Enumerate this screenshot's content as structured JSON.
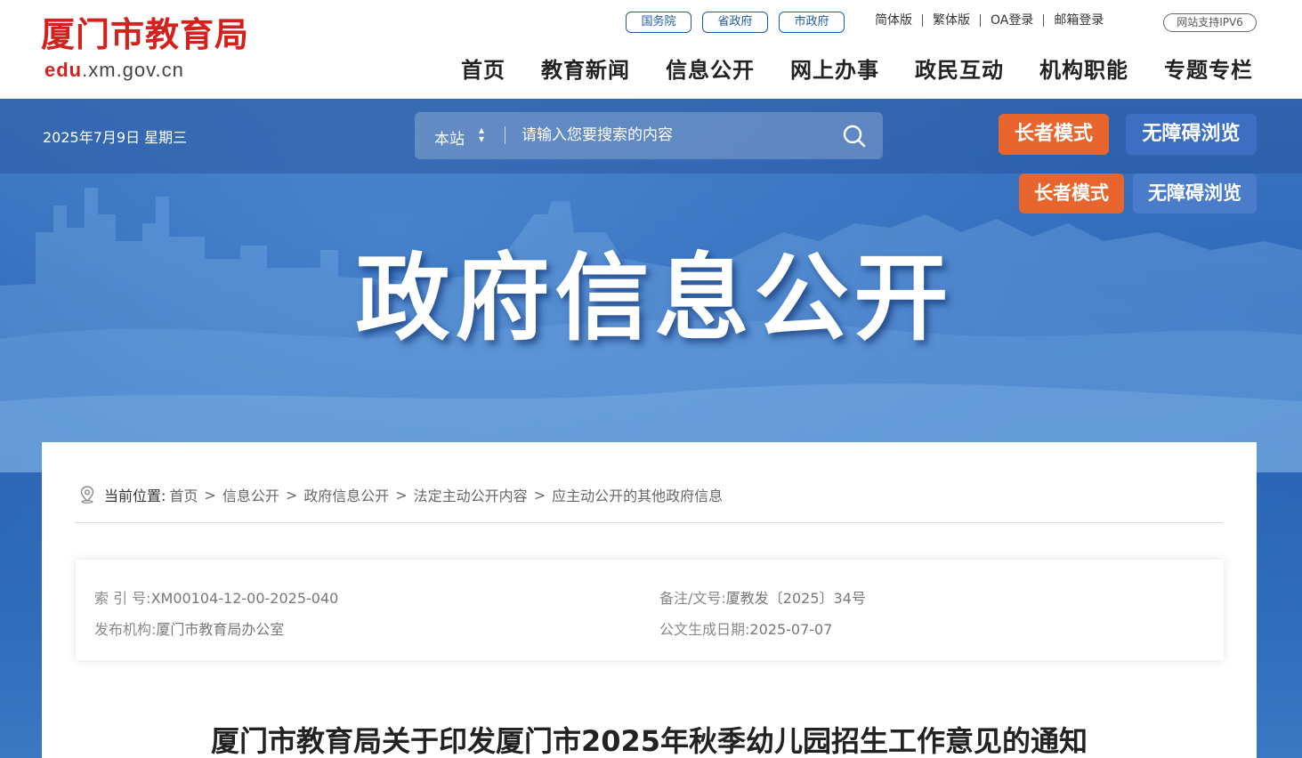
{
  "header": {
    "logo_cn": "厦门市教育局",
    "logo_url_edu": "edu",
    "logo_url_rest": ".xm.gov.cn",
    "gov_links": [
      "国务院",
      "省政府",
      "市政府"
    ],
    "util_links": [
      "简体版",
      "繁体版",
      "OA登录",
      "邮箱登录"
    ],
    "ipv6_badge": "网站支持IPV6",
    "nav": [
      "首页",
      "教育新闻",
      "信息公开",
      "网上办事",
      "政民互动",
      "机构职能",
      "专题专栏"
    ]
  },
  "banner": {
    "date": "2025年7月9日 星期三",
    "search_scope": "本站",
    "search_placeholder": "请输入您要搜索的内容",
    "elder_mode": "长者模式",
    "accessible_mode": "无障碍浏览",
    "title": "政府信息公开"
  },
  "breadcrumb": {
    "label": "当前位置:",
    "items": [
      "首页",
      "信息公开",
      "政府信息公开",
      "法定主动公开内容",
      "应主动公开的其他政府信息"
    ],
    "separator": ">"
  },
  "meta": {
    "index_key": "索 引 号:",
    "index_val": "XM00104-12-00-2025-040",
    "docno_key": "备注/文号:",
    "docno_val": "厦教发〔2025〕34号",
    "publisher_key": "发布机构:",
    "publisher_val": "厦门市教育局办公室",
    "date_key": "公文生成日期:",
    "date_val": "2025-07-07"
  },
  "document": {
    "title": "厦门市教育局关于印发厦门市2025年秋季幼儿园招生工作意见的通知"
  },
  "colors": {
    "brand_red": "#d5211d",
    "gov_blue": "#1f5aa6",
    "elder_orange": "#e8652d",
    "access_blue": "#3c6fc2"
  }
}
